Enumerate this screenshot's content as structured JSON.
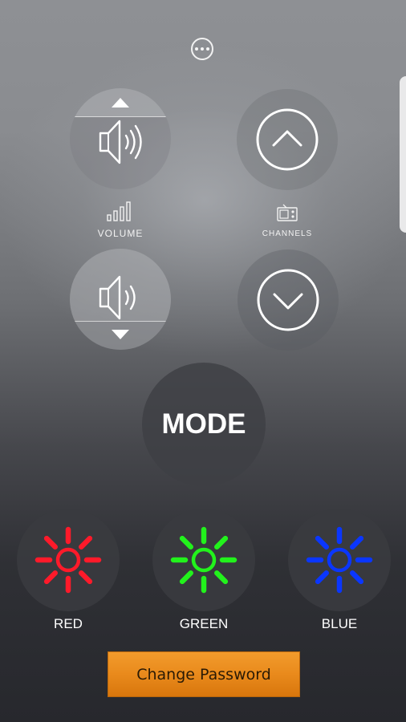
{
  "volume": {
    "label": "VOLUME",
    "up_icon": "speaker-icon",
    "down_icon": "speaker-icon",
    "label_icon": "bar-chart-icon"
  },
  "channels": {
    "label": "CHANNELS",
    "up_icon": "chevron-up-icon",
    "down_icon": "chevron-down-icon",
    "label_icon": "radio-icon"
  },
  "more_menu": {
    "icon": "more-dots-icon"
  },
  "mode": {
    "label": "MODE"
  },
  "colors": [
    {
      "name": "RED",
      "hex": "#ff1a2a",
      "icon": "sun-icon"
    },
    {
      "name": "GREEN",
      "hex": "#22f21c",
      "icon": "sun-icon"
    },
    {
      "name": "BLUE",
      "hex": "#0a36ff",
      "icon": "sun-icon"
    }
  ],
  "change_password": {
    "label": "Change Password",
    "color": "#ec8d1f"
  }
}
